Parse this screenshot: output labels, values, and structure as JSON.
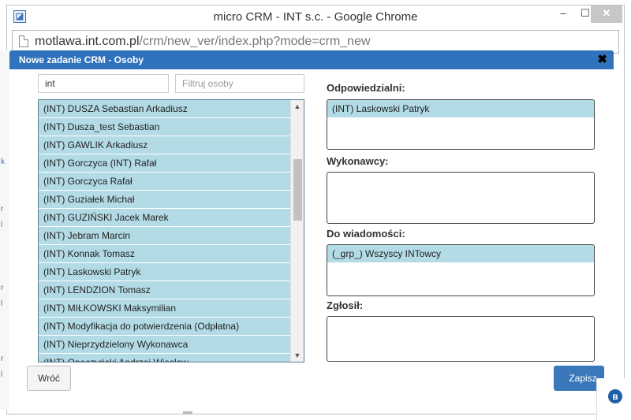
{
  "window": {
    "title": "micro CRM - INT s.c. - Google Chrome",
    "controls": {
      "minimize": "–",
      "maximize": "☐",
      "close": "✕"
    }
  },
  "address": {
    "host": "motlawa.int.com.pl",
    "path": "/crm/new_ver/index.php?mode=crm_new"
  },
  "dialog": {
    "title": "Nowe zadanie CRM - Osoby",
    "close": "✖"
  },
  "filters": {
    "search_value": "int",
    "filter_placeholder": "Filtruj osoby"
  },
  "people_list": [
    "(INT) DUSZA Sebastian Arkadiusz",
    "(INT) Dusza_test Sebastian",
    "(INT) GAWLIK Arkadiusz",
    "(INT) Gorczyca (INT) Rafał",
    "(INT) Gorczyca Rafał",
    "(INT) Guziałek Michał",
    "(INT) GUZIŃSKI Jacek Marek",
    "(INT) Jebram Marcin",
    "(INT) Konnak Tomasz",
    "(INT) Laskowski Patryk",
    "(INT) LENDZION Tomasz",
    "(INT) MIŁKOWSKI Maksymilian",
    "(INT) Modyfikacja do potwierdzenia (Odpłatna)",
    "(INT) Nieprzydzielony Wykonawca",
    "(INT) Opoczyński Andrzej Wiesław"
  ],
  "sections": {
    "responsible": {
      "label": "Odpowiedzialni:",
      "items": [
        "(INT) Laskowski Patryk"
      ]
    },
    "executors": {
      "label": "Wykonawcy:",
      "items": []
    },
    "cc": {
      "label": "Do wiadomości:",
      "items": [
        "(_grp_) Wszyscy INTowcy"
      ]
    },
    "reported_by": {
      "label": "Zgłosił:",
      "items": []
    }
  },
  "buttons": {
    "back": "Wróć",
    "save": "Zapisz"
  },
  "colors": {
    "header_blue": "#2f73bd",
    "selected_bg": "#b3dbe6",
    "save_blue": "#3a78bb"
  },
  "icons": {
    "app": "chrome-app-icon",
    "bluetooth": "bluetooth-icon"
  },
  "tray": {
    "bluetooth_glyph": "ʙ"
  }
}
